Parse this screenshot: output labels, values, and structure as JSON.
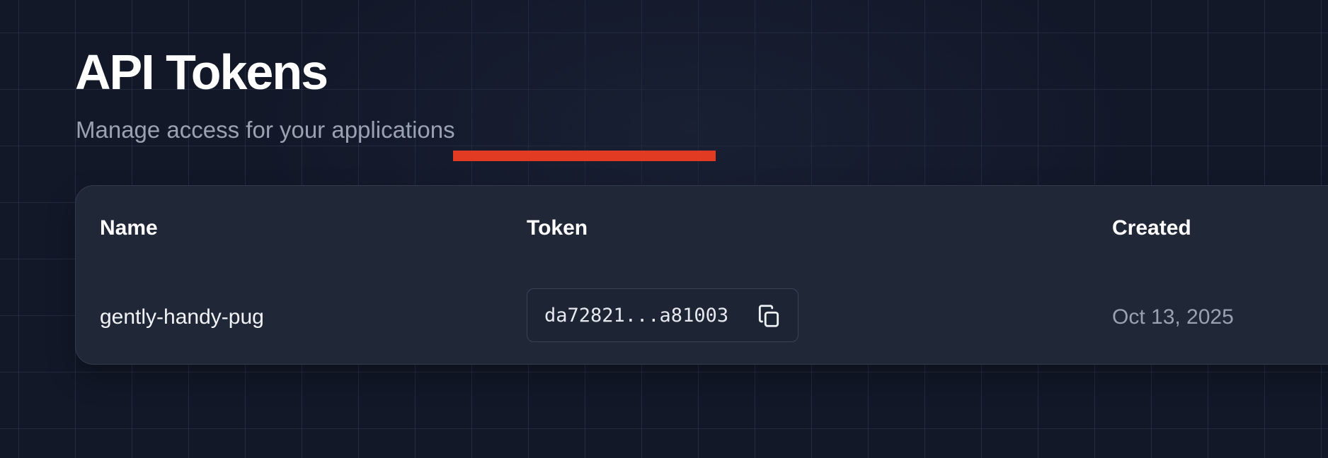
{
  "header": {
    "title": "API Tokens",
    "subtitle": "Manage access for your applications"
  },
  "table": {
    "columns": [
      "Name",
      "Token",
      "Created"
    ],
    "rows": [
      {
        "name": "gently-handy-pug",
        "token": "da72821...a81003",
        "created": "Oct 13, 2025"
      }
    ]
  },
  "icons": {
    "copy": "copy-icon"
  },
  "colors": {
    "background": "#121828",
    "card": "#202838",
    "muted_text": "#9aa2b1",
    "highlight": "#e23b24"
  }
}
